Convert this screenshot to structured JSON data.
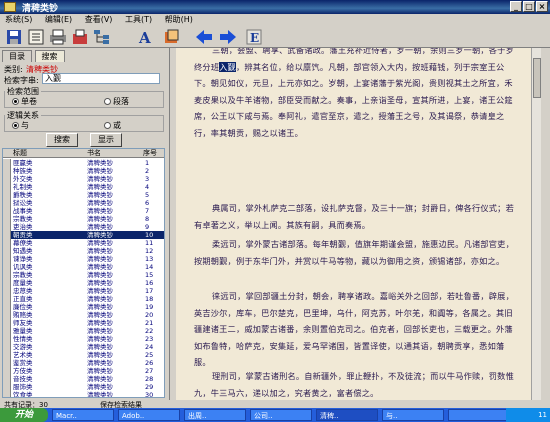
{
  "window": {
    "title": "清稗类钞"
  },
  "menu": [
    "系统(S)",
    "编辑(E)",
    "查看(V)",
    "工具(T)",
    "帮助(H)"
  ],
  "tabs": [
    "目录",
    "搜索"
  ],
  "search": {
    "category_label": "类别:",
    "category_value": "清稗类钞",
    "keyword_label": "检索字串:",
    "keyword_value": "入觐",
    "scope_legend": "检索范围",
    "scope_options": [
      "单卷",
      "段落"
    ],
    "logic_legend": "逻辑关系",
    "logic_options": [
      "与",
      "或"
    ],
    "search_button": "搜索",
    "show_button": "显示"
  },
  "results": {
    "columns": [
      "标题",
      "书名",
      "序号"
    ],
    "rows": [
      [
        "匪赢类",
        "清稗类钞",
        "1"
      ],
      [
        "种族类",
        "清稗类钞",
        "2"
      ],
      [
        "外交类",
        "清稗类钞",
        "3"
      ],
      [
        "礼制类",
        "清稗类钞",
        "4"
      ],
      [
        "爵秩类",
        "清稗类钞",
        "5"
      ],
      [
        "狱讼类",
        "清稗类钞",
        "6"
      ],
      [
        "战事类",
        "清稗类钞",
        "7"
      ],
      [
        "宗教类",
        "清稗类钞",
        "8"
      ],
      [
        "吏治类",
        "清稗类钞",
        "9"
      ],
      [
        "朝贡类",
        "清稗类钞",
        "10"
      ],
      [
        "幕僚类",
        "清稗类钞",
        "11"
      ],
      [
        "知遇类",
        "清稗类钞",
        "12"
      ],
      [
        "谏诤类",
        "清稗类钞",
        "13"
      ],
      [
        "讥讽类",
        "清稗类钞",
        "14"
      ],
      [
        "宗教类",
        "清稗类钞",
        "15"
      ],
      [
        "度量类",
        "清稗类钞",
        "16"
      ],
      [
        "忠荩类",
        "清稗类钞",
        "17"
      ],
      [
        "正直类",
        "清稗类钞",
        "18"
      ],
      [
        "廉俭类",
        "清稗类钞",
        "19"
      ],
      [
        "贿赂类",
        "清稗类钞",
        "20"
      ],
      [
        "师友类",
        "清稗类钞",
        "21"
      ],
      [
        "雅量类",
        "清稗类钞",
        "22"
      ],
      [
        "性情类",
        "清稗类钞",
        "23"
      ],
      [
        "交游类",
        "清稗类钞",
        "24"
      ],
      [
        "艺术类",
        "清稗类钞",
        "25"
      ],
      [
        "鉴赏类",
        "清稗类钞",
        "26"
      ],
      [
        "方伎类",
        "清稗类钞",
        "27"
      ],
      [
        "音技类",
        "清稗类钞",
        "28"
      ],
      [
        "服饰类",
        "清稗类钞",
        "29"
      ],
      [
        "饮食类",
        "清稗类钞",
        "30"
      ]
    ],
    "selected_index": 9
  },
  "status": {
    "left": "共有记录：30",
    "right": "保存检索结果"
  },
  "document": {
    "paragraphs": [
      "三朝，会盟、聘享、武备诸政。藩王充补近侍者，岁一朝，余则三岁一朝，各于岁终分班入觐，辨其名位，给以廪饩。凡朝，部官领入大内，按班藉钱，列于宗室王公下。朝见如仪，元旦，上元亦如之。岁朝，上宴诸藩于紫光阁，贵则视其土之所宜，禾麦皮果以及牛羊诸物，部臣受而献之。奏事，上亲诣圣母，宣其所进，上宴，诸王公筵席，公王以下咸与焉。奉阿礼，遣官至京，遣之，授藩王之号，及其谒祭，恭请皇之行，率其朝贡，赐之以诸王。",
      "典属司，掌外札萨克二部落，设扎萨克督，及三十一旗；封爵日，俾各行仪式；若有卓著之义，举以上闻。其族有嗣，具而奏焉。",
      "柔远司，掌外蒙古诸部落。每年朝觐，值旗年期谨会盟，施惠边民。凡诸部官吏，按期朝觐，例于东华门外，并赏以牛马等物，藏以为御用之资，颁锡诸部，亦如之。",
      "徕远司，掌回部疆土分封，朝会，聘享诸政。嘉峪关外之回部，若吐鲁番，辟展，英吉沙尔，库车，巴尔楚克，巴里坤，乌什，阿克苏，叶尔羌，和阗等，各属之。其旧疆建诸王二，威加蒙古诸番，余则置伯克司之。伯克者，回部长吏也，三载更之。外藩如布鲁特，哈萨克，安集延，爱乌罕诸国，皆置译使，以通其语，朝聘贡享，悉如藩服。",
      "理刑司，掌蒙古诸刑名。自新疆外，罪止鞭扑，不及徒流；而以牛马作赎，罚数惟九，牛三马六，递以加之，究者黄之，富者偿之。"
    ],
    "highlight": "入觐"
  },
  "taskbar": {
    "start": "开始",
    "items": [
      "Macr..",
      "Adob..",
      "出周..",
      "公司..",
      "清稗..",
      "与..",
      ""
    ],
    "tray_time": "11"
  }
}
